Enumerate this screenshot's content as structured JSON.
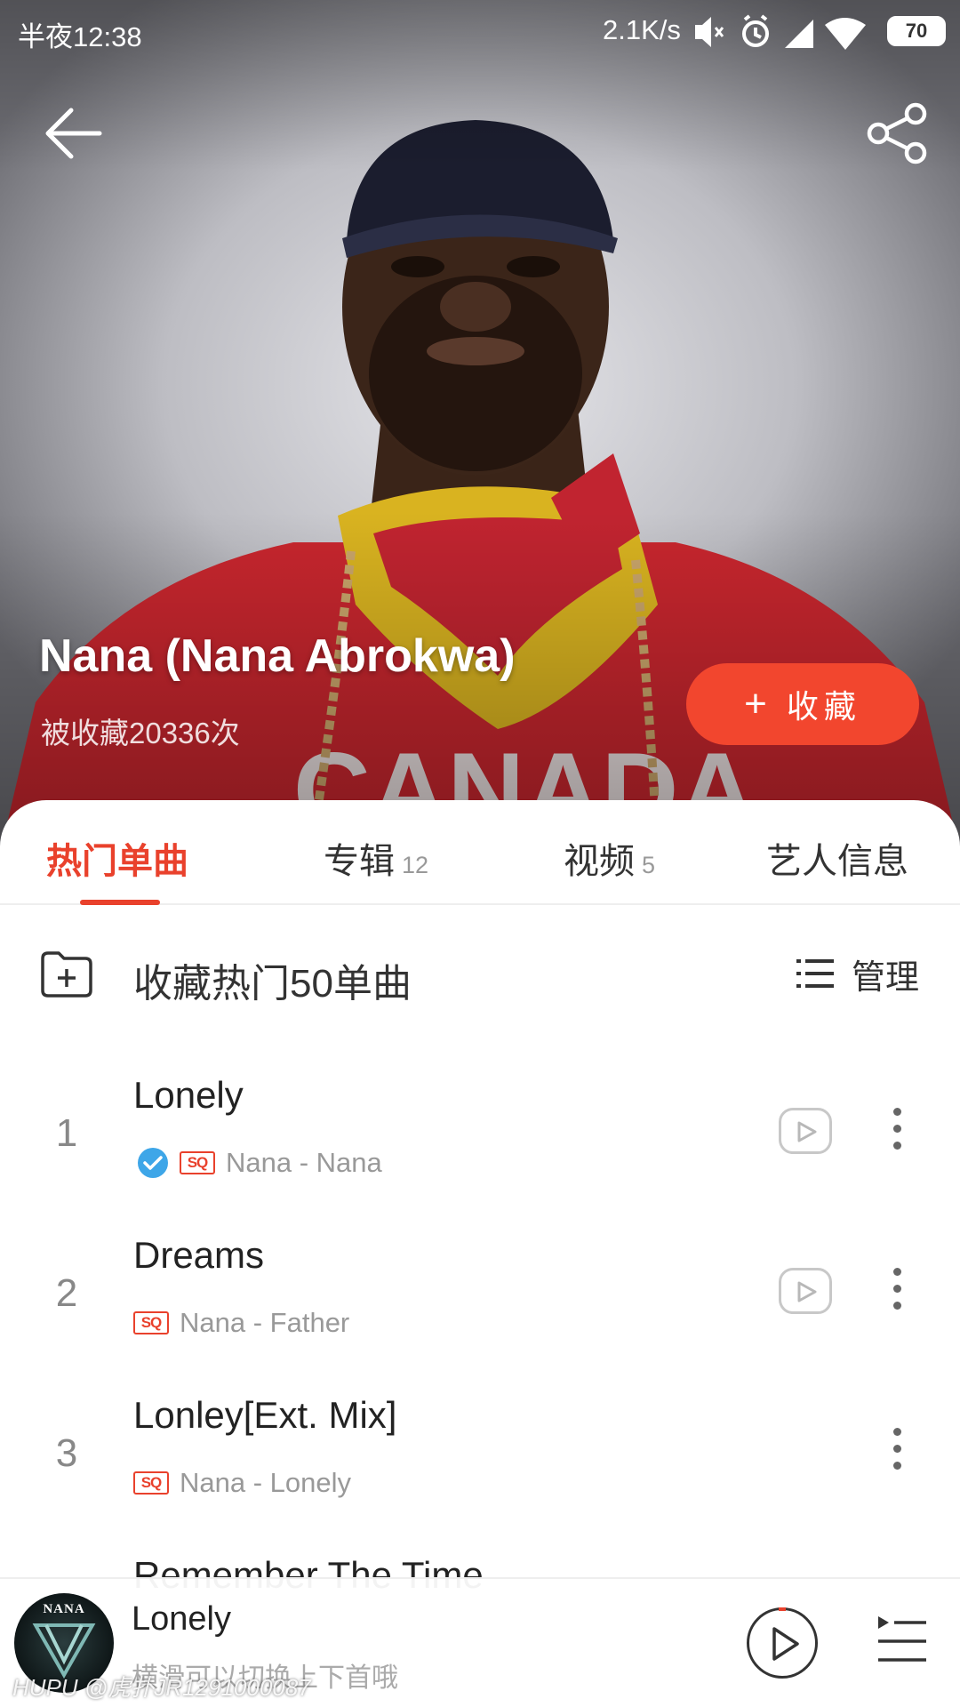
{
  "status_bar": {
    "time": "半夜12:38",
    "net_speed": "2.1K/s",
    "battery": "70",
    "icons": [
      "mute-icon",
      "alarm-icon",
      "signal-icon",
      "wifi-icon",
      "battery-icon"
    ]
  },
  "header": {
    "back_icon": "arrow-left-icon",
    "share_icon": "share-icon"
  },
  "artist": {
    "name": "Nana (Nana Abrokwa)",
    "favorited": "被收藏20336次",
    "collect_label": "收藏",
    "collect_icon": "+"
  },
  "tabs": [
    {
      "label": "热门单曲",
      "count": "",
      "active": true
    },
    {
      "label": "专辑",
      "count": "12",
      "active": false
    },
    {
      "label": "视频",
      "count": "5",
      "active": false
    },
    {
      "label": "艺人信息",
      "count": "",
      "active": false
    }
  ],
  "collect_all": {
    "label": "收藏热门50单曲",
    "icon": "folder-add-icon",
    "manage_label": "管理",
    "manage_icon": "list-icon"
  },
  "songs": [
    {
      "rank": "1",
      "title": "Lonely",
      "badge": "SQ",
      "verified": true,
      "artist_album": "Nana - Nana",
      "has_mv": true
    },
    {
      "rank": "2",
      "title": "Dreams",
      "badge": "SQ",
      "verified": false,
      "artist_album": "Nana - Father",
      "has_mv": true
    },
    {
      "rank": "3",
      "title": "Lonley[Ext. Mix]",
      "badge": "SQ",
      "verified": false,
      "artist_album": "Nana - Lonely",
      "has_mv": false
    },
    {
      "rank": "",
      "title": "Remember The Time",
      "badge": "",
      "verified": false,
      "artist_album": "",
      "has_mv": false
    }
  ],
  "now_playing": {
    "title": "Lonely",
    "hint": "横滑可以切换上下首哦",
    "cover_text": "NANA",
    "play_icon": "play-icon",
    "playlist_icon": "playlist-icon"
  },
  "watermark": "HUPU @虎扑JR1291000087",
  "colors": {
    "accent": "#e9412c",
    "collect_button": "#f2462e"
  }
}
